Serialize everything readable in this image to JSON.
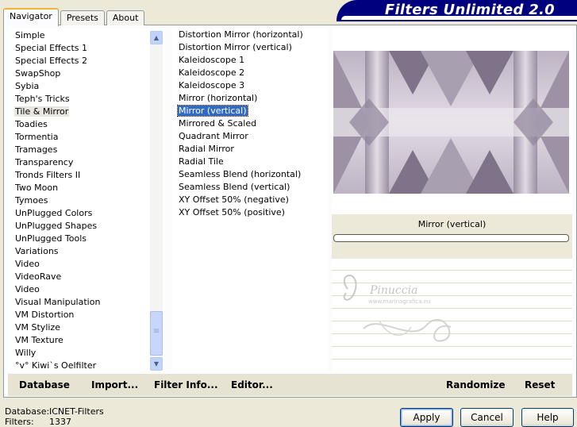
{
  "tabs": [
    "Navigator",
    "Presets",
    "About"
  ],
  "app_title": "Filters Unlimited 2.0",
  "categories": [
    "Simple",
    "Special Effects 1",
    "Special Effects 2",
    "SwapShop",
    "Sybia",
    "Teph's Tricks",
    "Tile & Mirror",
    "Toadies",
    "Tormentia",
    "Tramages",
    "Transparency",
    "Tronds Filters II",
    "Two Moon",
    "Tymoes",
    "UnPlugged Colors",
    "UnPlugged Shapes",
    "UnPlugged Tools",
    "Variations",
    "Video",
    "VideoRave",
    "Video",
    "Visual Manipulation",
    "VM Distortion",
    "VM Stylize",
    "VM Texture",
    "Willy",
    "°v° Kiwi`s Oelfilter"
  ],
  "selected_category": "Tile & Mirror",
  "filters": [
    "Distortion Mirror (horizontal)",
    "Distortion Mirror (vertical)",
    "Kaleidoscope 1",
    "Kaleidoscope 2",
    "Kaleidoscope 3",
    "Mirror (horizontal)",
    "Mirror (vertical)",
    "Mirrored & Scaled",
    "Quadrant Mirror",
    "Radial Mirror",
    "Radial Tile",
    "Seamless Blend (horizontal)",
    "Seamless Blend (vertical)",
    "XY Offset 50% (negative)",
    "XY Offset 50% (positive)"
  ],
  "selected_filter": "Mirror (vertical)",
  "preview_filter_name": "Mirror (vertical)",
  "watermark": {
    "name": "Pinuccia",
    "site": "www.marinagrafica.eu"
  },
  "toolbar": {
    "database_label": "Database",
    "import_label": "Import...",
    "filter_info_label": "Filter Info...",
    "editor_label": "Editor...",
    "randomize_label": "Randomize",
    "reset_label": "Reset"
  },
  "status": {
    "database_label": "Database:",
    "database_value": "ICNET-Filters",
    "filters_label": "Filters:",
    "filters_value": "1337"
  },
  "buttons": {
    "apply": "Apply",
    "cancel": "Cancel",
    "help": "Help"
  },
  "colors": {
    "banner": "#00007f",
    "selection": "#316ac5",
    "background": "#ece9d8"
  }
}
